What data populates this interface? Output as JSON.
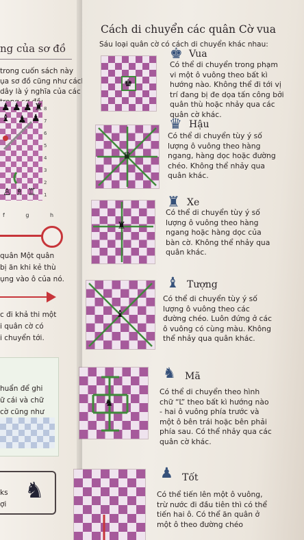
{
  "left_page": {
    "heading": "ng của sơ đồ",
    "intro_lines": [
      "trong cuốn sách này",
      "ụa sơ đồ cũng như cách",
      "dây là ý nghĩa của các",
      "trong sơ đồ:"
    ],
    "rank_numbers": [
      "8",
      "7",
      "6",
      "5",
      "4",
      "3",
      "2",
      "1"
    ],
    "file_letters": "f  g  h",
    "red_line_lines": [
      "quân Một quân",
      "bị ăn khi kẻ thù",
      "ụng vào ô của nó."
    ],
    "arrow_lines": [
      "c đi khả thi một",
      "i quân cờ có",
      "i chuyển tới."
    ],
    "box_lines": [
      "huẩn để ghi",
      "ữ cái và chữ",
      "cờ cũng như"
    ],
    "bottom_lines": [
      "ks",
      "ợi"
    ]
  },
  "title": "Cách di chuyển các quân Cờ vua",
  "subtitle": "Sáu loại quân cờ có cách di chuyển khác nhau:",
  "pieces": [
    {
      "name": "Vua",
      "icon": "king-icon",
      "glyph": "♚",
      "lines": [
        "Có thể di chuyển trong phạm",
        "vi một ô vuông theo bất kì",
        "hướng nào. Không thể đi tới vị",
        "trí đang bị đe dọa tấn công bởi",
        "quân thù hoặc nhảy qua các",
        "quân cờ khác."
      ]
    },
    {
      "name": "Hậu",
      "icon": "queen-icon",
      "glyph": "♛",
      "lines": [
        "Có thể di chuyển tùy ý số",
        "lượng ô vuông theo hàng",
        "ngang, hàng dọc hoặc đường",
        "chéo. Không thể nhảy qua",
        "quân khác."
      ]
    },
    {
      "name": "Xe",
      "icon": "rook-icon",
      "glyph": "♜",
      "lines": [
        "Có thể di chuyển tùy ý số",
        "lượng ô vuông theo hàng",
        "ngang hoặc hàng dọc của",
        "bàn cờ. Không thể nhảy qua",
        "quân khác."
      ]
    },
    {
      "name": "Tượng",
      "icon": "bishop-icon",
      "glyph": "♝",
      "lines": [
        "Có thể di chuyển tùy ý số",
        "lượng ô vuông theo các",
        "đường chéo. Luôn đứng ở các",
        "ô vuông có cùng màu. Không",
        "thể nhảy qua quân khác."
      ]
    },
    {
      "name": "Mã",
      "icon": "knight-icon",
      "glyph": "♞",
      "lines": [
        "Có thể di chuyển theo hình",
        "chữ “L” theo bất kì hướng nào",
        "- hai ô vuông phía trước và",
        "một ô bên trái hoặc bên phải",
        "phía sau. Có thể nhảy qua các",
        "quân cờ khác."
      ]
    },
    {
      "name": "Tốt",
      "icon": "pawn-icon",
      "glyph": "♟",
      "lines": [
        "Có thể tiến lên một ô vuông,",
        "trừ nước đi đầu tiên thì có thể",
        "tiến hai ô. Có thể ăn quân ở",
        "một ô theo đường chéo"
      ]
    }
  ],
  "colors": {
    "board_dark": "#a65a9b",
    "board_light": "#efe3ee",
    "arrow_green": "#3f8a3a",
    "arrow_red": "#c7353a",
    "icon_blue": "#36517a"
  }
}
